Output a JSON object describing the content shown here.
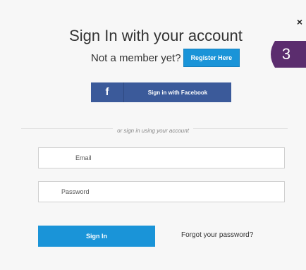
{
  "close": {
    "label": "×"
  },
  "title": "Sign In with your account",
  "register": {
    "prompt": "Not a member yet?",
    "button_label": "Register Here"
  },
  "step_badge": {
    "number": "3",
    "color": "#5b2d6e"
  },
  "facebook": {
    "icon": "f",
    "label": "Sign in with Facebook",
    "color": "#3b5a9a"
  },
  "divider_text": "or sign in using your account",
  "form": {
    "email_placeholder": "Email",
    "email_value": "",
    "password_placeholder": "Password",
    "password_value": ""
  },
  "signin_button": "Sign In",
  "forgot_link": "Forgot your password?",
  "colors": {
    "accent": "#1a94d8",
    "background": "#f7f7f7"
  }
}
